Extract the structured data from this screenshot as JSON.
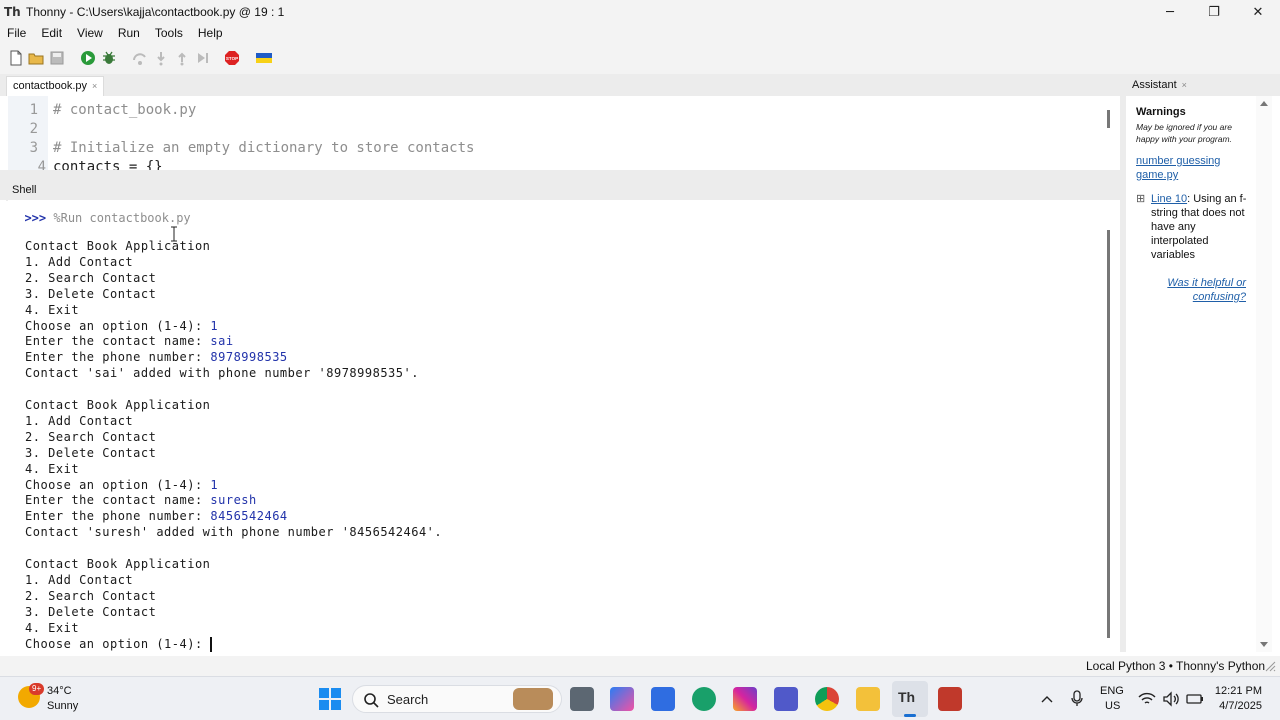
{
  "window": {
    "title": "Thonny  -  C:\\Users\\kajja\\contactbook.py  @  19 : 1",
    "app_icon": "Th",
    "minimize": "─",
    "maximize": "❐",
    "close": "✕"
  },
  "menu": [
    "File",
    "Edit",
    "View",
    "Run",
    "Tools",
    "Help"
  ],
  "toolbar": {
    "icons": [
      "new-file",
      "open-file",
      "save-file",
      "run",
      "debug",
      "step-over",
      "step-into",
      "step-out",
      "resume",
      "stop",
      "ukraine-flag"
    ],
    "stop_label": "STOP"
  },
  "editor": {
    "tab": "contactbook.py",
    "tab_close": "×",
    "lines": [
      {
        "num": "1",
        "text": "# contact_book.py"
      },
      {
        "num": "2",
        "text": ""
      },
      {
        "num": "3",
        "text": "# Initialize an empty dictionary to store contacts"
      },
      {
        "num": "4",
        "text": "contacts = {}"
      }
    ]
  },
  "shell": {
    "tab": "Shell",
    "prompt": ">>>",
    "command": "%Run contactbook.py",
    "lines": [
      {
        "text": "Contact Book Application"
      },
      {
        "text": "1. Add Contact"
      },
      {
        "text": "2. Search Contact"
      },
      {
        "text": "3. Delete Contact"
      },
      {
        "text": "4. Exit"
      },
      {
        "text": "Choose an option (1-4): ",
        "input": "1"
      },
      {
        "text": "Enter the contact name: ",
        "input": "sai"
      },
      {
        "text": "Enter the phone number: ",
        "input": "8978998535"
      },
      {
        "text": "Contact 'sai' added with phone number '8978998535'."
      },
      {
        "text": ""
      },
      {
        "text": "Contact Book Application"
      },
      {
        "text": "1. Add Contact"
      },
      {
        "text": "2. Search Contact"
      },
      {
        "text": "3. Delete Contact"
      },
      {
        "text": "4. Exit"
      },
      {
        "text": "Choose an option (1-4): ",
        "input": "1"
      },
      {
        "text": "Enter the contact name: ",
        "input": "suresh"
      },
      {
        "text": "Enter the phone number: ",
        "input": "8456542464"
      },
      {
        "text": "Contact 'suresh' added with phone number '8456542464'."
      },
      {
        "text": ""
      },
      {
        "text": "Contact Book Application"
      },
      {
        "text": "1. Add Contact"
      },
      {
        "text": "2. Search Contact"
      },
      {
        "text": "3. Delete Contact"
      },
      {
        "text": "4. Exit"
      },
      {
        "text": "Choose an option (1-4): "
      }
    ]
  },
  "assistant": {
    "tab": "Assistant",
    "tab_close": "×",
    "heading": "Warnings",
    "note": "May be ignored if you are happy with your program.",
    "file_link": "number guessing game.py",
    "expander": "⊞",
    "line_link": "Line 10",
    "warning": ": Using an f-string that does not have any interpolated variables",
    "feedback": "Was it helpful or confusing?"
  },
  "statusbar": {
    "interpreter": "Local Python 3  •  Thonny's Python"
  },
  "taskbar": {
    "weather_temp": "34°C",
    "weather_desc": "Sunny",
    "weather_badge": "9+",
    "search": "Search",
    "lang1": "ENG",
    "lang2": "US",
    "time": "12:21 PM",
    "date": "4/7/2025",
    "apps": [
      "start",
      "search",
      "copilot-fish",
      "task-view",
      "copilot",
      "store",
      "edge",
      "instagram",
      "teams",
      "chrome",
      "file-explorer",
      "thonny",
      "snipping-tool"
    ]
  },
  "colors": {
    "accent": "#2233aa",
    "link": "#1f5fa8"
  }
}
